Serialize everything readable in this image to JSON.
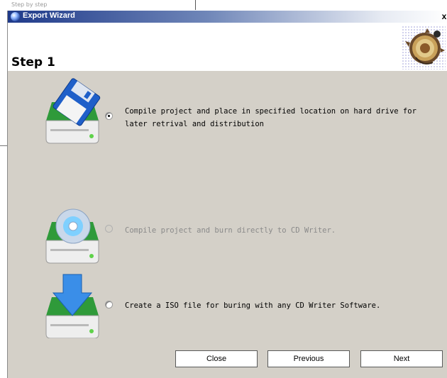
{
  "background": {
    "partial_text": "Step by step"
  },
  "window": {
    "title": "Export Wizard",
    "close_glyph": "x"
  },
  "header": {
    "step_title": "Step 1",
    "graphic_icon": "wizard-gear-graphic-icon"
  },
  "options": [
    {
      "label_line1": "Compile project and place in specified location on hard drive for",
      "label_line2": "later retrival and distribution",
      "icon": "floppy-drive-icon",
      "selected": true,
      "enabled": true
    },
    {
      "label_line1": "Compile project and burn directly to CD Writer.",
      "label_line2": "",
      "icon": "cd-drive-icon",
      "selected": false,
      "enabled": false
    },
    {
      "label_line1": "Create a ISO file for buring with any CD Writer Software.",
      "label_line2": "",
      "icon": "download-drive-icon",
      "selected": false,
      "enabled": true
    }
  ],
  "buttons": {
    "close_label": "Close",
    "previous_label": "Previous",
    "next_label": "Next"
  },
  "colors": {
    "dialog_bg": "#d4d0c8",
    "titlebar_start": "#1f3a8a",
    "drive_green": "#3db24a",
    "disabled_text": "#8a8a8a"
  }
}
